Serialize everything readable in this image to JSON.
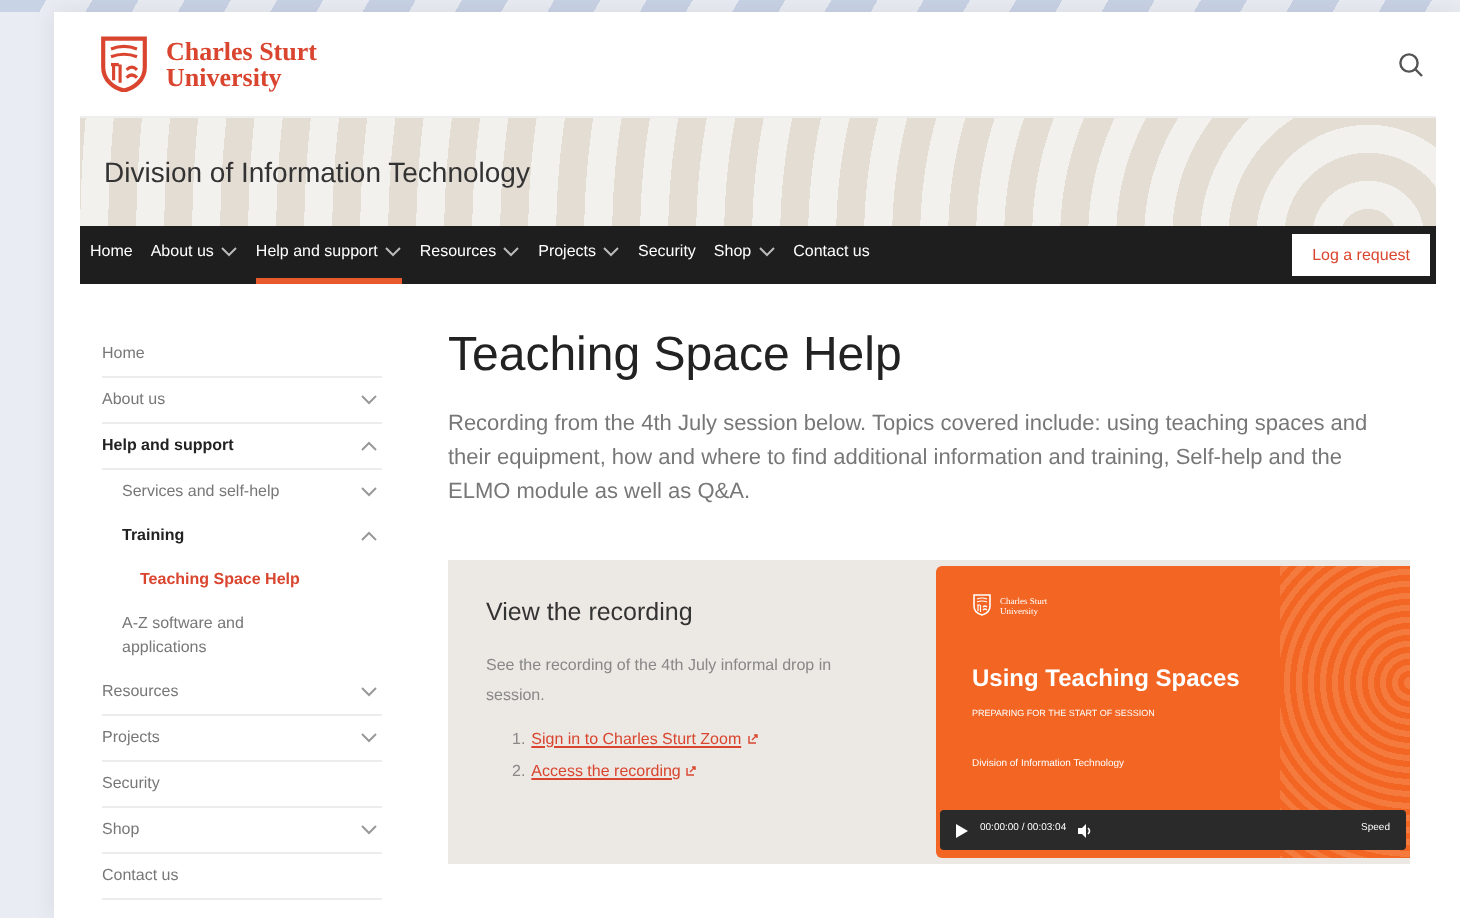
{
  "header": {
    "logo_line1": "Charles Sturt",
    "logo_line2": "University"
  },
  "banner": {
    "title": "Division of Information Technology"
  },
  "nav": {
    "items": [
      {
        "label": "Home",
        "kind": "link",
        "selected": false
      },
      {
        "label": "About us",
        "kind": "menu",
        "selected": false
      },
      {
        "label": "Help and support",
        "kind": "menu",
        "selected": true
      },
      {
        "label": "Resources",
        "kind": "menu",
        "selected": false
      },
      {
        "label": "Projects",
        "kind": "menu",
        "selected": false
      },
      {
        "label": "Security",
        "kind": "link",
        "selected": false
      },
      {
        "label": "Shop",
        "kind": "menu",
        "selected": false
      },
      {
        "label": "Contact us",
        "kind": "link",
        "selected": false
      }
    ],
    "action": "Log a request"
  },
  "sidebar": {
    "items": [
      {
        "label": "Home",
        "selected": false
      },
      {
        "label": "About us",
        "expanded": false,
        "selected": false
      },
      {
        "label": "Help and support",
        "expanded": true,
        "selected": false,
        "children": [
          {
            "label": "Services and self-help",
            "expanded": false,
            "selected": false
          },
          {
            "label": "Training",
            "expanded": true,
            "selected": false,
            "children": [
              {
                "label": "Teaching Space Help",
                "selected": true
              }
            ]
          },
          {
            "label": "A-Z software and applications",
            "selected": false
          }
        ]
      },
      {
        "label": "Resources",
        "expanded": false,
        "selected": false
      },
      {
        "label": "Projects",
        "expanded": false,
        "selected": false
      },
      {
        "label": "Security",
        "selected": false
      },
      {
        "label": "Shop",
        "expanded": false,
        "selected": false
      },
      {
        "label": "Contact us",
        "selected": false
      }
    ]
  },
  "main": {
    "title": "Teaching Space Help",
    "intro": "Recording from the 4th July session below. Topics covered include: using teaching spaces and their equipment, how and where to find additional information and training, Self-help and the ELMO module as well as Q&A.",
    "recording": {
      "title": "View the recording",
      "text": "See the recording of the 4th July informal drop in session.",
      "steps": [
        {
          "number": "1.",
          "link": "Sign in to Charles Sturt Zoom"
        },
        {
          "number": "2.",
          "link": "Access the recording"
        }
      ]
    },
    "video": {
      "logo_line1": "Charles Sturt",
      "logo_line2": "University",
      "title": "Using Teaching Spaces",
      "subtitle": "PREPARING FOR THE START OF SESSION",
      "presenter": "Division of Information Technology",
      "time": "00:00:00 / 00:03:04",
      "speed": "Speed"
    }
  }
}
